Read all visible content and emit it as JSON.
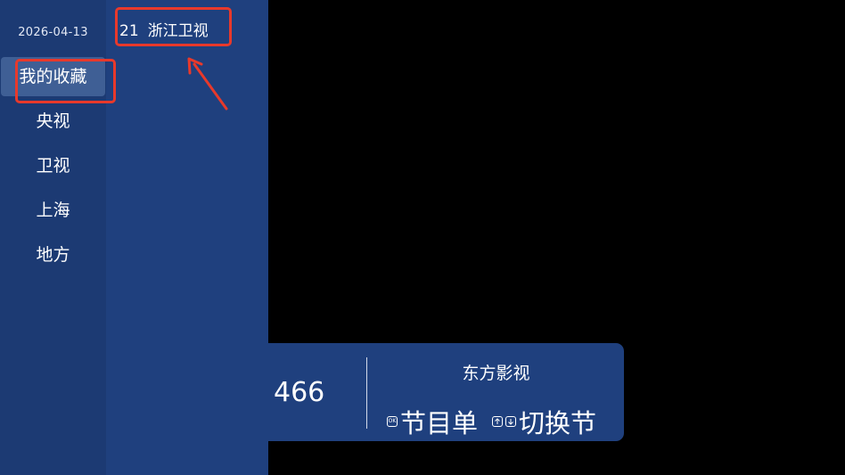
{
  "sidebar": {
    "date": "2026-04-13",
    "categories": [
      {
        "label": "我的收藏",
        "selected": true
      },
      {
        "label": "央视",
        "selected": false
      },
      {
        "label": "卫视",
        "selected": false
      },
      {
        "label": "上海",
        "selected": false
      },
      {
        "label": "地方",
        "selected": false
      }
    ]
  },
  "channel_list": {
    "items": [
      {
        "number": "21",
        "name": "浙江卫视"
      }
    ]
  },
  "info_bar": {
    "channel_number": "466",
    "channel_name": "东方影视",
    "hints": [
      {
        "key_icon": "ok-key-icon",
        "key_text": "OK",
        "label": "节目单"
      },
      {
        "key_icon": "up-down-keys-icon",
        "label": "切换节"
      }
    ]
  },
  "annotations": {
    "color": "#e8392b"
  }
}
